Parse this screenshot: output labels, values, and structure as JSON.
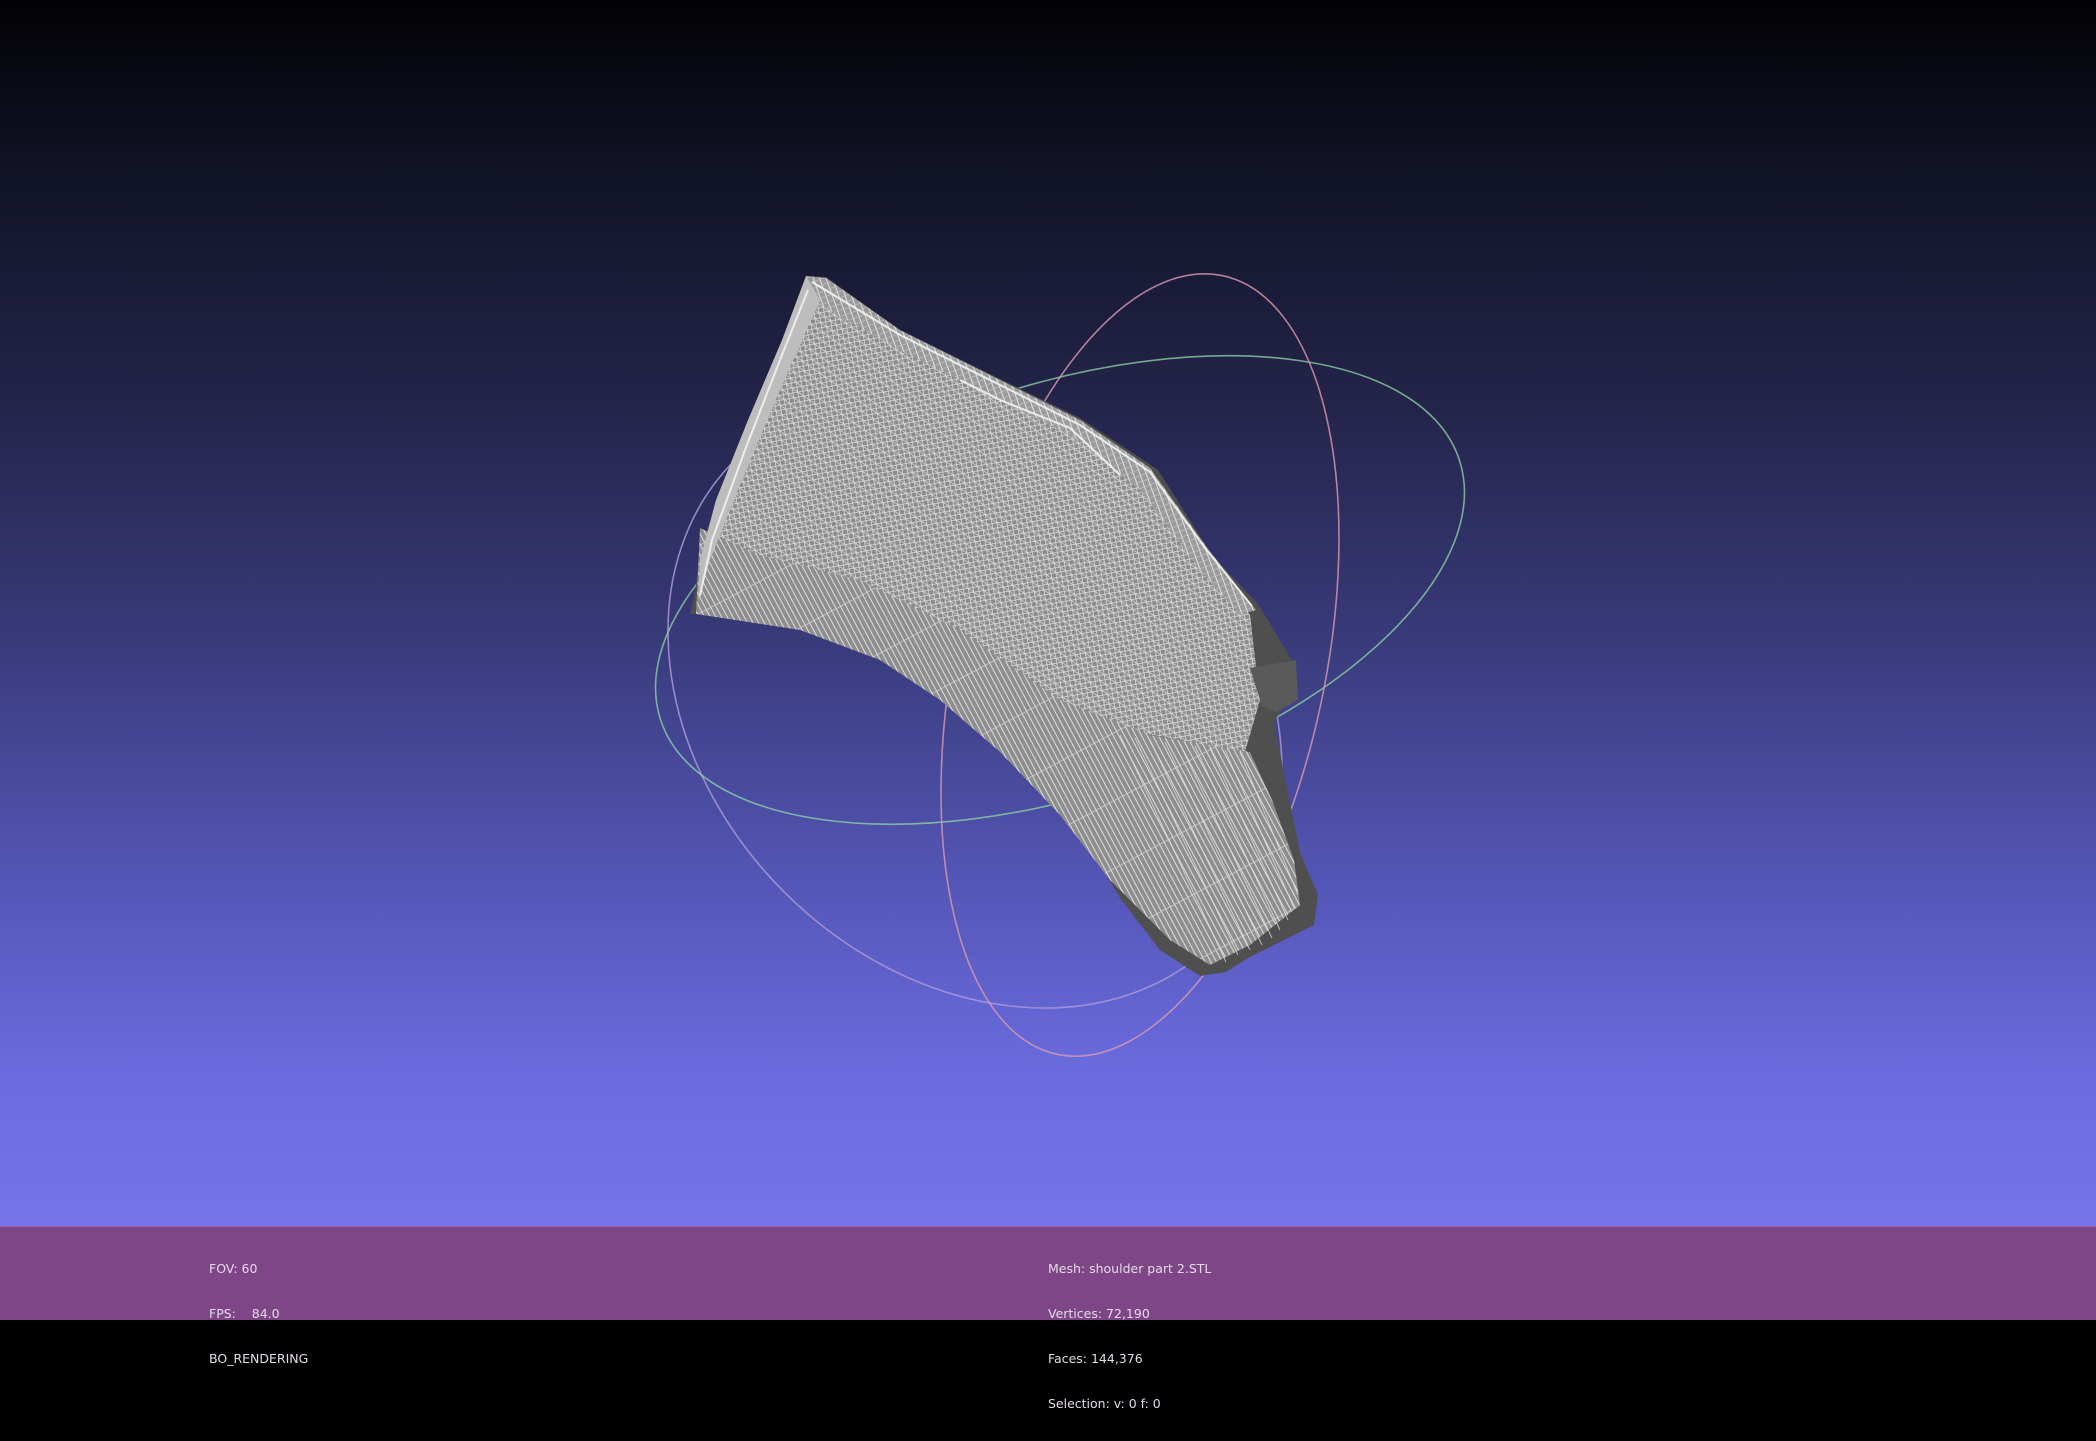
{
  "viewer": {
    "background_top_color": "#020204",
    "background_bottom_color": "#7475ea",
    "info_bar_color": "#7e4686",
    "mesh_color": "#8c8c8c",
    "wireframe_color": "#d6d6d6",
    "trackball": {
      "x_axis_color": "#d89ab0",
      "y_axis_color": "#8fd8a8",
      "z_axis_color": "#a896d8"
    }
  },
  "info_left": {
    "fov": "FOV: 60",
    "fps": "FPS:    84.0",
    "mode": "BO_RENDERING"
  },
  "info_right": {
    "mesh": "Mesh: shoulder part 2.STL",
    "vertices": "Vertices: 72,190",
    "faces": "Faces: 144,376",
    "selection": "Selection: v: 0 f: 0"
  }
}
